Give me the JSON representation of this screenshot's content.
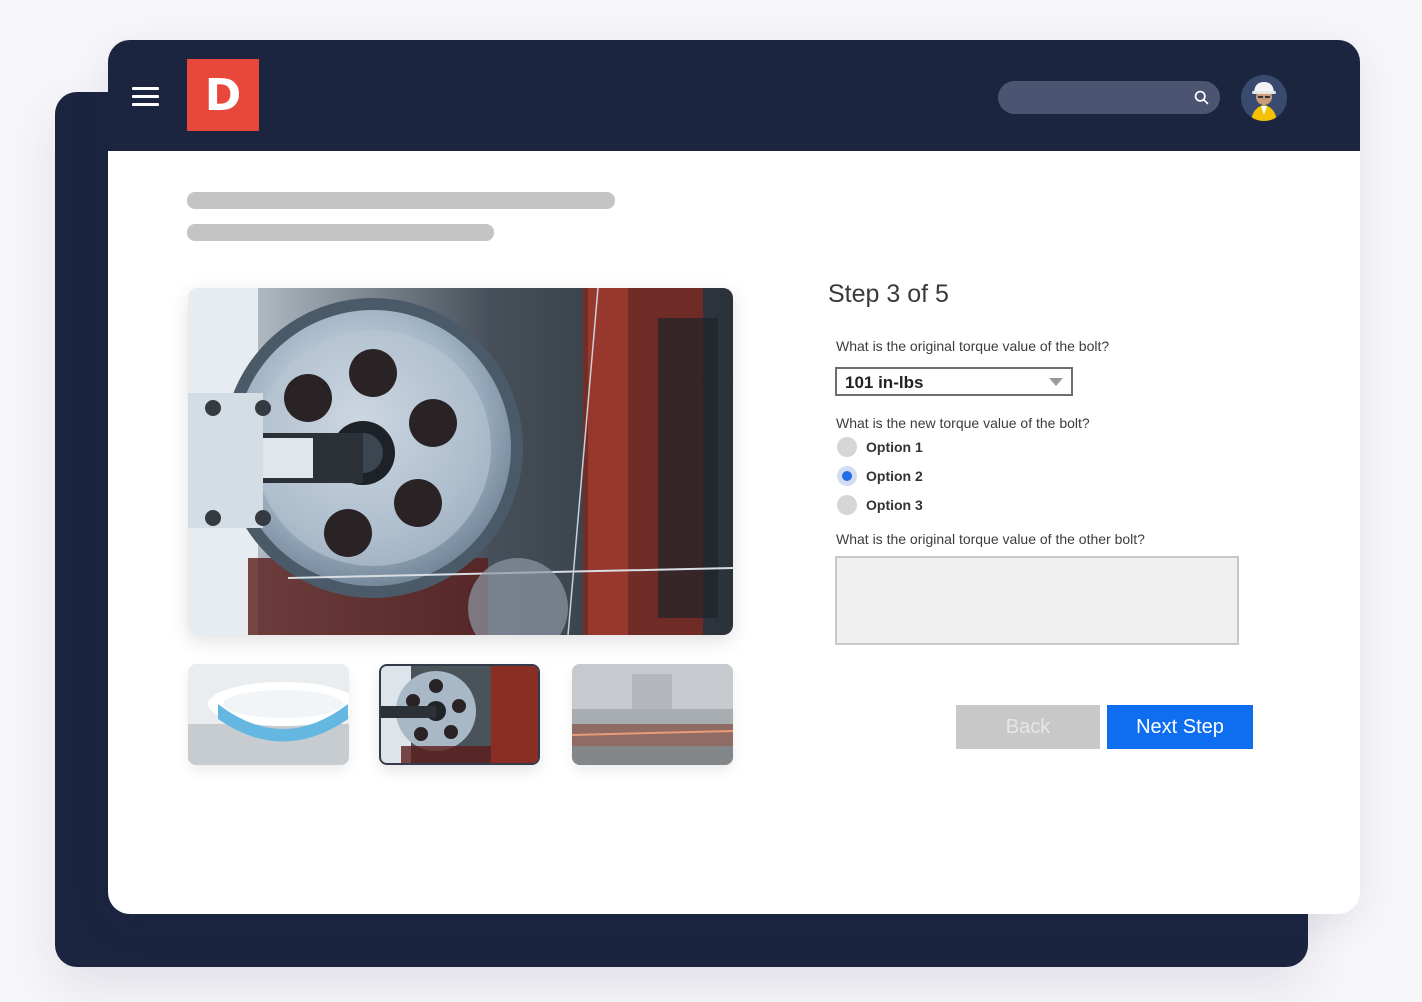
{
  "header": {
    "logo_text": "D",
    "search": {
      "placeholder": ""
    }
  },
  "form": {
    "step_label": "Step 3 of 5",
    "q1": {
      "label": "What is the original torque value of the bolt?",
      "selected_value": "101 in-lbs"
    },
    "q2": {
      "label": "What is the new torque value of the bolt?",
      "options": [
        "Option 1",
        "Option 2",
        "Option 3"
      ],
      "selected_index": 1
    },
    "q3": {
      "label": "What is the original torque value of the other bolt?",
      "value": ""
    },
    "back_label": "Back",
    "next_label": "Next Step"
  },
  "gallery": {
    "selected_thumbnail": 1
  },
  "colors": {
    "navy": "#1b2540",
    "logo_red": "#e8483c",
    "primary_blue": "#0f6ef0",
    "disabled_gray": "#c8c8c8"
  },
  "icons": [
    "menu-icon",
    "search-icon",
    "avatar"
  ]
}
